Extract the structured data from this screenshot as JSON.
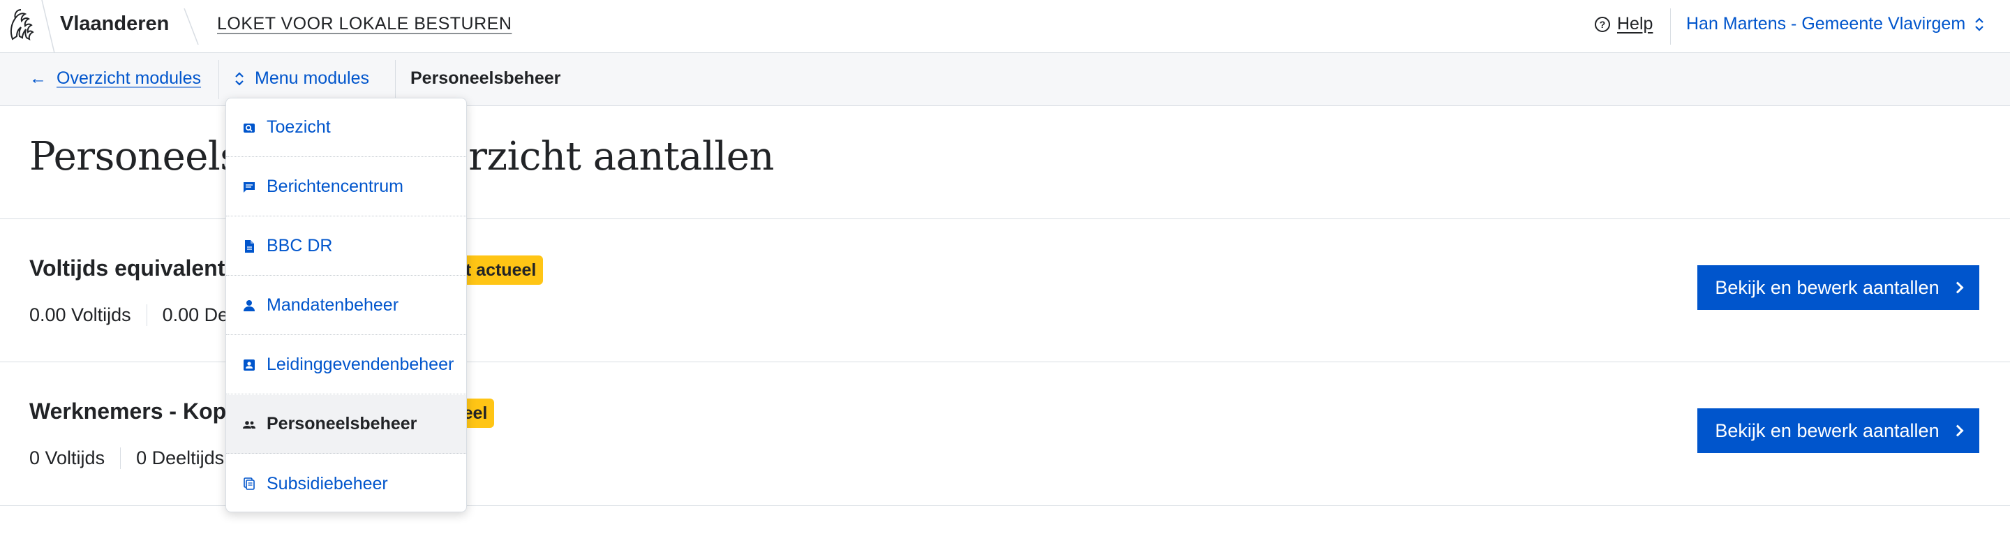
{
  "header": {
    "brand": "Vlaanderen",
    "app_title": "LOKET VOOR LOKALE BESTUREN",
    "help_label": "Help",
    "help_icon": "?",
    "account_label": "Han Martens - Gemeente Vlavirgem"
  },
  "module_nav": {
    "back_arrow": "←",
    "back_label": "Overzicht modules",
    "menu_label": "Menu modules",
    "current_label": "Personeelsbeheer"
  },
  "page": {
    "title": "Personeelsbeheer: overzicht aantallen"
  },
  "sections": [
    {
      "title": "Voltijds equivalenten",
      "badge": "Niet actueel",
      "stats": [
        "0.00 Voltijds",
        "0.00 Deeltijds"
      ],
      "button_label": "Bekijk en bewerk aantallen"
    },
    {
      "title": "Werknemers - Koppen",
      "badge": "Niet actueel",
      "stats": [
        "0 Voltijds",
        "0 Deeltijds"
      ],
      "button_label": "Bekijk en bewerk aantallen"
    }
  ],
  "dropdown": {
    "items": [
      {
        "label": "Toezicht",
        "icon": "search-document-icon",
        "active": false
      },
      {
        "label": "Berichtencentrum",
        "icon": "message-icon",
        "active": false
      },
      {
        "label": "BBC DR",
        "icon": "document-icon",
        "active": false
      },
      {
        "label": "Mandatenbeheer",
        "icon": "user-icon",
        "active": false
      },
      {
        "label": "Leidinggevendenbeheer",
        "icon": "contact-card-icon",
        "active": false
      },
      {
        "label": "Personeelsbeheer",
        "icon": "users-icon",
        "active": true
      },
      {
        "label": "Subsidiebeheer",
        "icon": "copy-icon",
        "active": false
      }
    ]
  },
  "colors": {
    "accent": "#0055cc",
    "badge": "#ffc515",
    "border": "#d8dde3",
    "text": "#212326"
  }
}
